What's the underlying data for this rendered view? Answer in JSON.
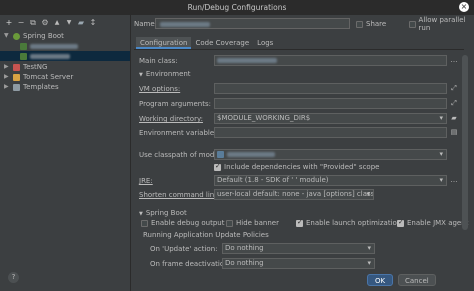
{
  "window": {
    "title": "Run/Debug Configurations",
    "close_glyph": "×"
  },
  "toolbar": {
    "add": "+",
    "remove": "−",
    "copy": "⧉",
    "settings": "⚙",
    "up": "▲",
    "down": "▼",
    "folder": "▰",
    "sort": "↕"
  },
  "tree": {
    "spring_boot": "Spring Boot",
    "testng": "TestNG",
    "tomcat": "Tomcat Server",
    "templates": "Templates"
  },
  "header": {
    "name_label": "Name:",
    "name_value": "",
    "share_label": "Share",
    "parallel_label": "Allow parallel run"
  },
  "tabs": [
    "Configuration",
    "Code Coverage",
    "Logs"
  ],
  "config": {
    "main_class_label": "Main class:",
    "main_class_value": "",
    "environment_header": "Environment",
    "vm_options_label": "VM options:",
    "program_args_label": "Program arguments:",
    "working_dir_label": "Working directory:",
    "working_dir_value": "$MODULE_WORKING_DIR$",
    "env_vars_label": "Environment variables:",
    "classpath_label": "Use classpath of module:",
    "include_provided_label": "Include dependencies with \"Provided\" scope",
    "jre_label": "JRE:",
    "jre_value": "Default (1.8 - SDK of '                    ' module)",
    "shorten_label": "Shorten command line:",
    "shorten_value": "user-local default: none - java [options] classname [args]",
    "spring_boot_header": "Spring Boot",
    "debug_output_label": "Enable debug output",
    "hide_banner_label": "Hide banner",
    "launch_opt_label": "Enable launch optimization",
    "jmx_label": "Enable JMX agent",
    "policies_header": "Running Application Update Policies",
    "on_update_label": "On 'Update' action:",
    "on_update_value": "Do nothing",
    "on_frame_label": "On frame deactivation:",
    "on_frame_value": "Do nothing"
  },
  "buttons": {
    "ok": "OK",
    "cancel": "Cancel",
    "help": "?"
  },
  "colors": {
    "accent": "#4a88c7",
    "selection": "#0d293e",
    "background": "#3c3f41"
  }
}
